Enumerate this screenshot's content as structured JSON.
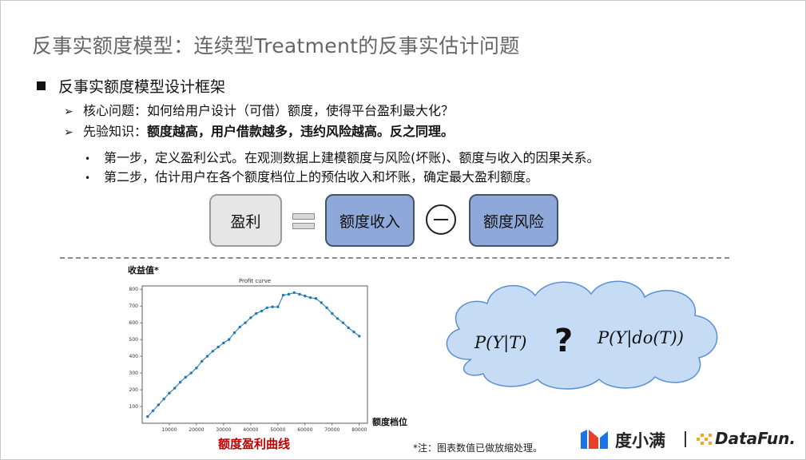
{
  "slide": {
    "title": "反事实额度模型：连续型Treatment的反事实估计问题",
    "heading": "反事实额度模型设计框架",
    "q1_prefix": "核心问题：",
    "q1_body": "如何给用户设计（可借）额度，使得平台盈利最大化？",
    "q2_prefix": "先验知识：",
    "q2_body": "额度越高，用户借款越多，违约风险越高。反之同理。",
    "steps": [
      "第一步，定义盈利公式。在观测数据上建模额度与风险(坏账)、额度与收入的因果关系。",
      "第二步，估计用户在各个额度档位上的预估收入和坏账，确定最大盈利额度。"
    ]
  },
  "formula_boxes": {
    "profit": "盈利",
    "revenue": "额度收入",
    "risk": "额度风险"
  },
  "chart_labels": {
    "ylabel": "收益值*",
    "xlabel": "额度档位",
    "caption": "额度盈利曲线",
    "note": "*注：图表数值已做放缩处理。"
  },
  "chart_data": {
    "type": "line",
    "title": "Profit curve",
    "xlabel": "额度档位",
    "ylabel": "收益值*",
    "xlim": [
      0,
      83000
    ],
    "ylim": [
      0,
      820
    ],
    "xticks": [
      10000,
      20000,
      30000,
      40000,
      50000,
      60000,
      70000,
      80000
    ],
    "yticks": [
      100,
      200,
      300,
      400,
      500,
      600,
      700,
      800
    ],
    "x": [
      2000,
      4000,
      6000,
      8000,
      10000,
      12000,
      14000,
      16000,
      18000,
      20000,
      22000,
      24000,
      26000,
      28000,
      30000,
      32000,
      34000,
      36000,
      38000,
      40000,
      42000,
      44000,
      46000,
      48000,
      50000,
      52000,
      54000,
      56000,
      58000,
      60000,
      62000,
      64000,
      66000,
      68000,
      70000,
      72000,
      74000,
      76000,
      78000,
      80000
    ],
    "values": [
      40,
      75,
      110,
      145,
      180,
      210,
      245,
      275,
      300,
      330,
      370,
      400,
      430,
      455,
      480,
      500,
      540,
      575,
      600,
      630,
      655,
      670,
      690,
      695,
      695,
      765,
      770,
      780,
      770,
      760,
      750,
      745,
      720,
      690,
      655,
      625,
      600,
      570,
      545,
      520
    ],
    "line_color": "#1f77b4",
    "grid": false
  },
  "formulas": {
    "left": "P(Y|T)",
    "question": "?",
    "right_open": "P(",
    "right_inner": "Y|do(T)",
    "right_close": ")"
  },
  "logos": {
    "duxiaoman": "度小满",
    "datafun": "DataFun."
  },
  "colors": {
    "title_gray": "#666666",
    "box_blue": "#8ea8d9",
    "box_border": "#44546a",
    "caption_red": "#c00000",
    "cloud_fill": "#c5dcf4",
    "cloud_border": "#5b8fd6",
    "duxiaoman_blue": "#1a73e8",
    "duxiaoman_red": "#e8402b",
    "datafun_orange": "#f5a623"
  }
}
